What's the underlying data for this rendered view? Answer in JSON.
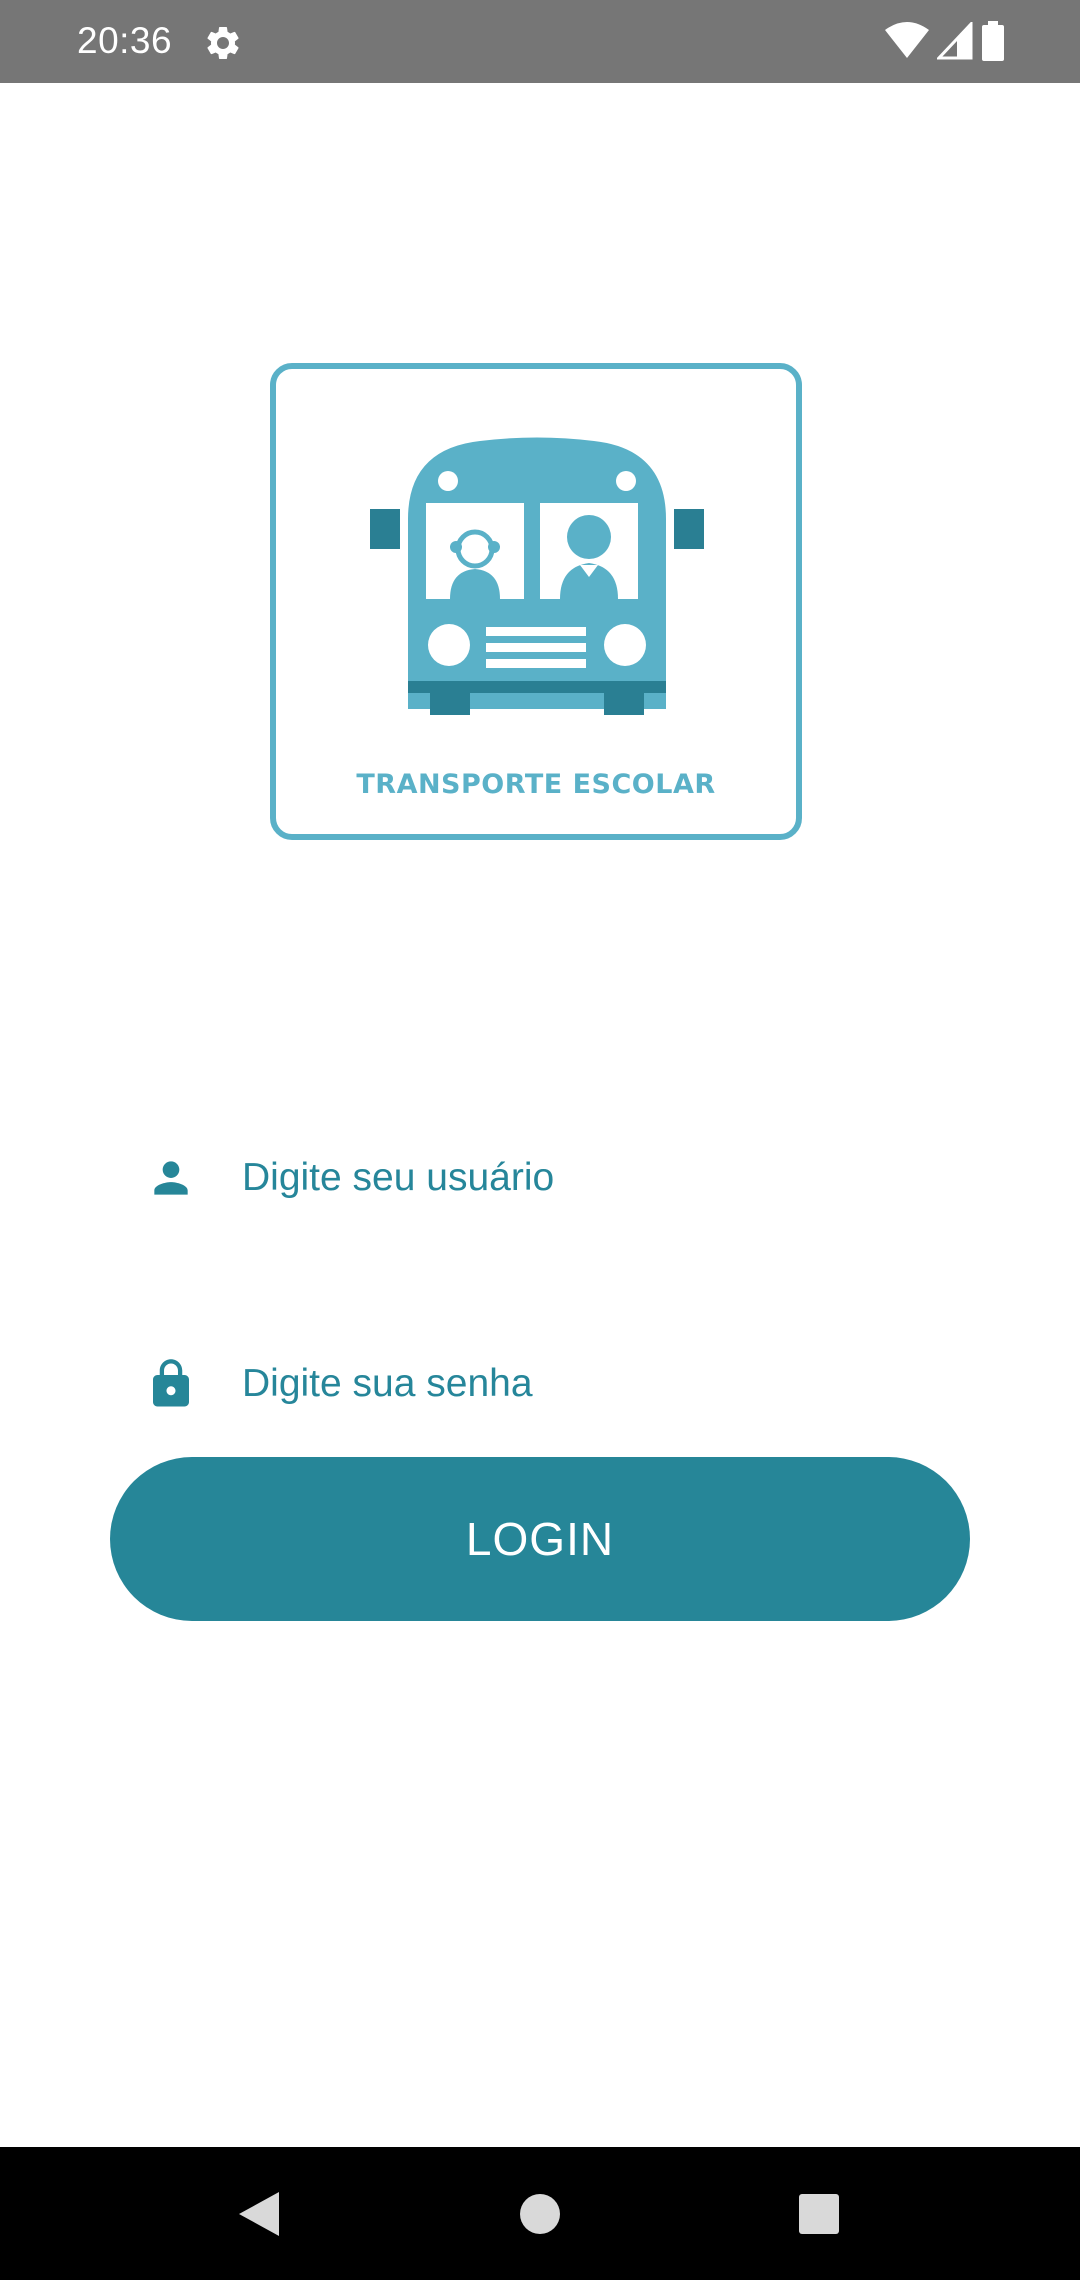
{
  "status_bar": {
    "time": "20:36",
    "icons": [
      "gear-icon",
      "wifi-icon",
      "signal-icon",
      "battery-icon"
    ]
  },
  "logo": {
    "text": "TRANSPORTE ESCOLAR",
    "color": "#5ab1c8",
    "dark_color": "#2a7f93"
  },
  "form": {
    "username": {
      "placeholder": "Digite seu usuário",
      "value": "",
      "icon": "person-icon"
    },
    "password": {
      "placeholder": "Digite sua senha",
      "value": "",
      "icon": "lock-icon"
    },
    "login_label": "LOGIN"
  },
  "nav_bar": {
    "buttons": [
      "back-icon",
      "home-icon",
      "recents-icon"
    ]
  },
  "colors": {
    "accent": "#268698",
    "status_bar": "#767676",
    "nav_bar": "#000000",
    "field_text": "#26869a"
  }
}
